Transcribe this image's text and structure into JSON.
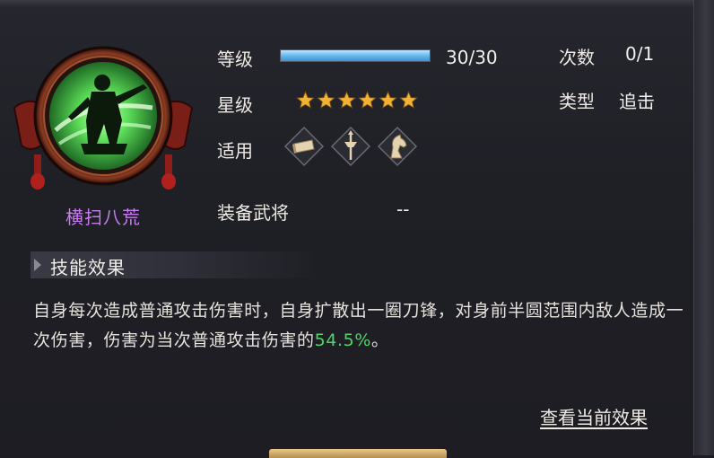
{
  "skill": {
    "name": "横扫八荒",
    "icon": "sweeping-warrior-emblem"
  },
  "stats": {
    "level_label": "等级",
    "level_value": "30/30",
    "level_progress": 1.0,
    "star_label": "星级",
    "star_count": 6,
    "apply_label": "适用",
    "apply_icons": [
      "shield-icon",
      "halberd-icon",
      "horse-icon"
    ],
    "equip_label": "装备武将",
    "equip_value": "--",
    "count_label": "次数",
    "count_value": "0/1",
    "type_label": "类型",
    "type_value": "追击"
  },
  "effect": {
    "header": "技能效果",
    "desc_prefix": "自身每次造成普通攻击伤害时，自身扩散出一圈刀锋，对身前半圆范围内敌人造成一次伤害，伤害为当次普通攻击伤害的",
    "desc_highlight": "54.5%",
    "desc_suffix": "。"
  },
  "actions": {
    "view_current": "查看当前效果"
  },
  "colors": {
    "skill_name": "#c77cf0",
    "highlight": "#4fd46a",
    "star": "#f2b233",
    "bar": "#66b8ee"
  }
}
